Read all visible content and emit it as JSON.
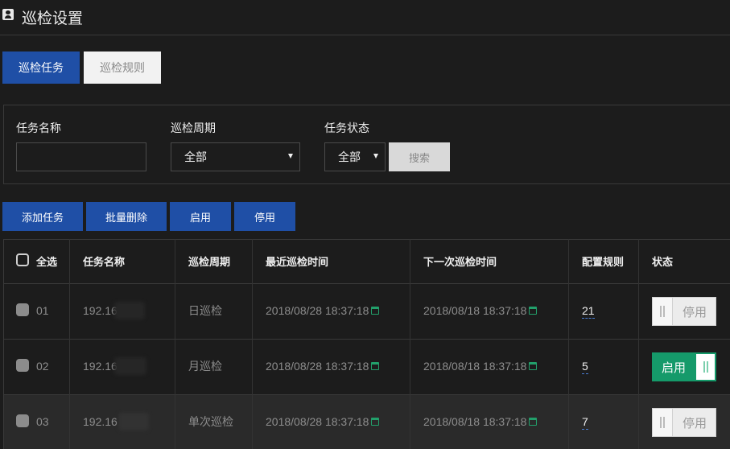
{
  "header": {
    "title": "巡检设置",
    "icon": "contact-card-icon"
  },
  "tabs": [
    {
      "label": "巡检任务",
      "active": true
    },
    {
      "label": "巡检规则",
      "active": false
    }
  ],
  "filters": {
    "task_name_label": "任务名称",
    "task_name_value": "",
    "period_label": "巡检周期",
    "period_value": "全部",
    "status_label": "任务状态",
    "status_value": "全部",
    "search_label": "搜索"
  },
  "actions": {
    "add": "添加任务",
    "batch_delete": "批量删除",
    "enable": "启用",
    "disable": "停用"
  },
  "table": {
    "headers": {
      "select_all": "全选",
      "name": "任务名称",
      "period": "巡检周期",
      "last_time": "最近巡检时间",
      "next_time": "下一次巡检时间",
      "rules": "配置规则",
      "status": "状态"
    },
    "rows": [
      {
        "no": "01",
        "name": "192.16",
        "period": "日巡检",
        "last_time": "2018/08/28 18:37:18",
        "next_time": "2018/08/18 18:37:18",
        "rules": "21",
        "status": "停用"
      },
      {
        "no": "02",
        "name": "192.16",
        "period": "月巡检",
        "last_time": "2018/08/28 18:37:18",
        "next_time": "2018/08/18 18:37:18",
        "rules": "5",
        "status": "启用"
      },
      {
        "no": "03",
        "name": "192.16",
        "period": "单次巡检",
        "last_time": "2018/08/28 18:37:18",
        "next_time": "2018/08/18 18:37:18",
        "rules": "7",
        "status": "停用"
      }
    ]
  },
  "colors": {
    "primary": "#1f4fa6",
    "success": "#159a6a",
    "accent_icon": "#22a06b",
    "background": "#1c1c1c"
  }
}
